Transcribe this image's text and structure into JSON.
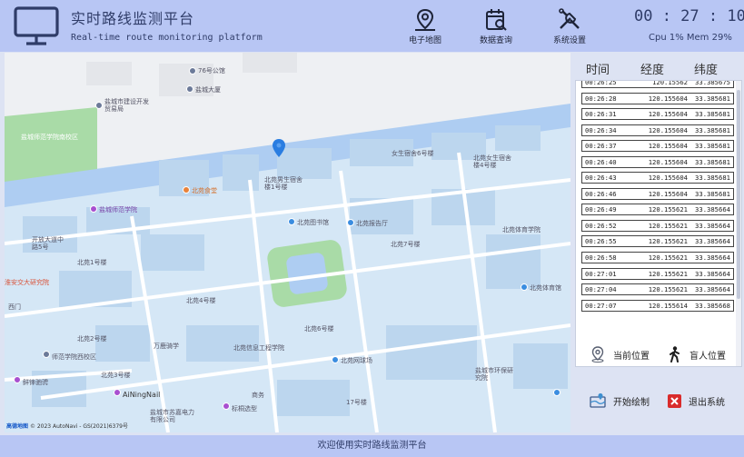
{
  "header": {
    "title_cn": "实时路线监测平台",
    "title_en": "Real-time route monitoring platform",
    "nav": [
      {
        "label": "电子地图",
        "icon": "map-pin-icon"
      },
      {
        "label": "数据查询",
        "icon": "calendar-search-icon"
      },
      {
        "label": "系统设置",
        "icon": "tools-icon"
      }
    ],
    "clock": "00 : 27 : 10",
    "sysinfo": "Cpu 1% Mem 29%"
  },
  "map": {
    "labels": [
      "76号公馆",
      "盐城大厦",
      "盐城市建设开发贸易局",
      "盐城师范学院",
      "开放大道中路5号",
      "北苑食堂",
      "北苑男生宿舍楼1号楼",
      "北苑图书馆",
      "北苑报告厅",
      "女生宿舍6号楼",
      "北苑女生宿舍楼4号楼",
      "北苑体育学院",
      "北苑7号楼",
      "北苑1号楼",
      "北苑2号楼",
      "北苑3号楼",
      "北苑4号楼",
      "北苑6号楼",
      "北苑体育馆",
      "北苑网球场",
      "北苑信息工程学院",
      "师范学院西校区",
      "万鹿骑学",
      "鲜锋驰骋",
      "AiNingNail",
      "盐城市苏嘉电力有限公司",
      "标桐选型",
      "盐城市环保研究院",
      "西门",
      "17号楼",
      "盐城师范学院南校区",
      "商务",
      "淮安交大研究院"
    ],
    "attribution_brand": "高德地图",
    "attribution_text": "© 2023 AutoNavi - GS(2021)6379号"
  },
  "panel": {
    "columns": [
      "时间",
      "经度",
      "纬度"
    ],
    "rows": [
      [
        "00:26:25",
        "120.15562",
        "33.385675"
      ],
      [
        "00:26:28",
        "120.155604",
        "33.385681"
      ],
      [
        "00:26:31",
        "120.155604",
        "33.385681"
      ],
      [
        "00:26:34",
        "120.155604",
        "33.385681"
      ],
      [
        "00:26:37",
        "120.155604",
        "33.385681"
      ],
      [
        "00:26:40",
        "120.155604",
        "33.385681"
      ],
      [
        "00:26:43",
        "120.155604",
        "33.385681"
      ],
      [
        "00:26:46",
        "120.155604",
        "33.385681"
      ],
      [
        "00:26:49",
        "120.155621",
        "33.385664"
      ],
      [
        "00:26:52",
        "120.155621",
        "33.385664"
      ],
      [
        "00:26:55",
        "120.155621",
        "33.385664"
      ],
      [
        "00:26:58",
        "120.155621",
        "33.385664"
      ],
      [
        "00:27:01",
        "120.155621",
        "33.385664"
      ],
      [
        "00:27:04",
        "120.155621",
        "33.385664"
      ],
      [
        "00:27:07",
        "120.155614",
        "33.385668"
      ]
    ],
    "actions": [
      {
        "label": "当前位置",
        "icon": "location-pin-icon"
      },
      {
        "label": "盲人位置",
        "icon": "walking-person-icon"
      },
      {
        "label": "开始绘制",
        "icon": "draw-map-icon"
      },
      {
        "label": "退出系统",
        "icon": "exit-icon"
      }
    ],
    "colors": {
      "exit": "#d92b2b",
      "accent": "#b8c6f4"
    }
  },
  "footer": {
    "text": "欢迎使用实时路线监测平台"
  }
}
